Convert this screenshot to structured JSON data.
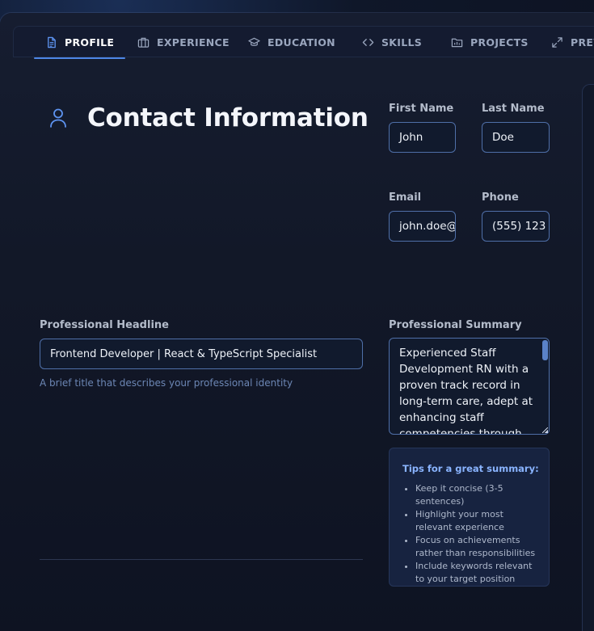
{
  "tabs": [
    {
      "label": "PROFILE",
      "icon": "document-icon",
      "active": true
    },
    {
      "label": "EXPERIENCE",
      "icon": "briefcase-icon",
      "active": false
    },
    {
      "label": "EDUCATION",
      "icon": "graduation-cap-icon",
      "active": false
    },
    {
      "label": "SKILLS",
      "icon": "code-icon",
      "active": false
    },
    {
      "label": "PROJECTS",
      "icon": "folder-icon",
      "active": false
    },
    {
      "label": "PREV",
      "icon": "expand-icon",
      "active": false
    }
  ],
  "section": {
    "title": "Contact Information",
    "icon": "user-icon"
  },
  "fields": {
    "first_name": {
      "label": "First Name",
      "value": "John"
    },
    "last_name": {
      "label": "Last Name",
      "value": "Doe"
    },
    "email": {
      "label": "Email",
      "value": "john.doe@"
    },
    "phone": {
      "label": "Phone",
      "value": "(555) 123"
    },
    "headline": {
      "label": "Professional Headline",
      "value": "Frontend Developer | React & TypeScript Specialist",
      "hint": "A brief title that describes your professional identity"
    },
    "summary": {
      "label": "Professional Summary",
      "value": "Experienced Staff Development RN with a proven track record in long-term care, adept at enhancing staff competencies through"
    }
  },
  "tips": {
    "title": "Tips for a great summary:",
    "items": [
      "Keep it concise (3-5 sentences)",
      "Highlight your most relevant experience",
      "Focus on achievements rather than responsibilities",
      "Include keywords relevant to your target position"
    ]
  },
  "colors": {
    "accent": "#4d86e6",
    "input_border": "#4f6fa8",
    "tips_title": "#8ab4ff",
    "hint": "#6c86b4"
  }
}
